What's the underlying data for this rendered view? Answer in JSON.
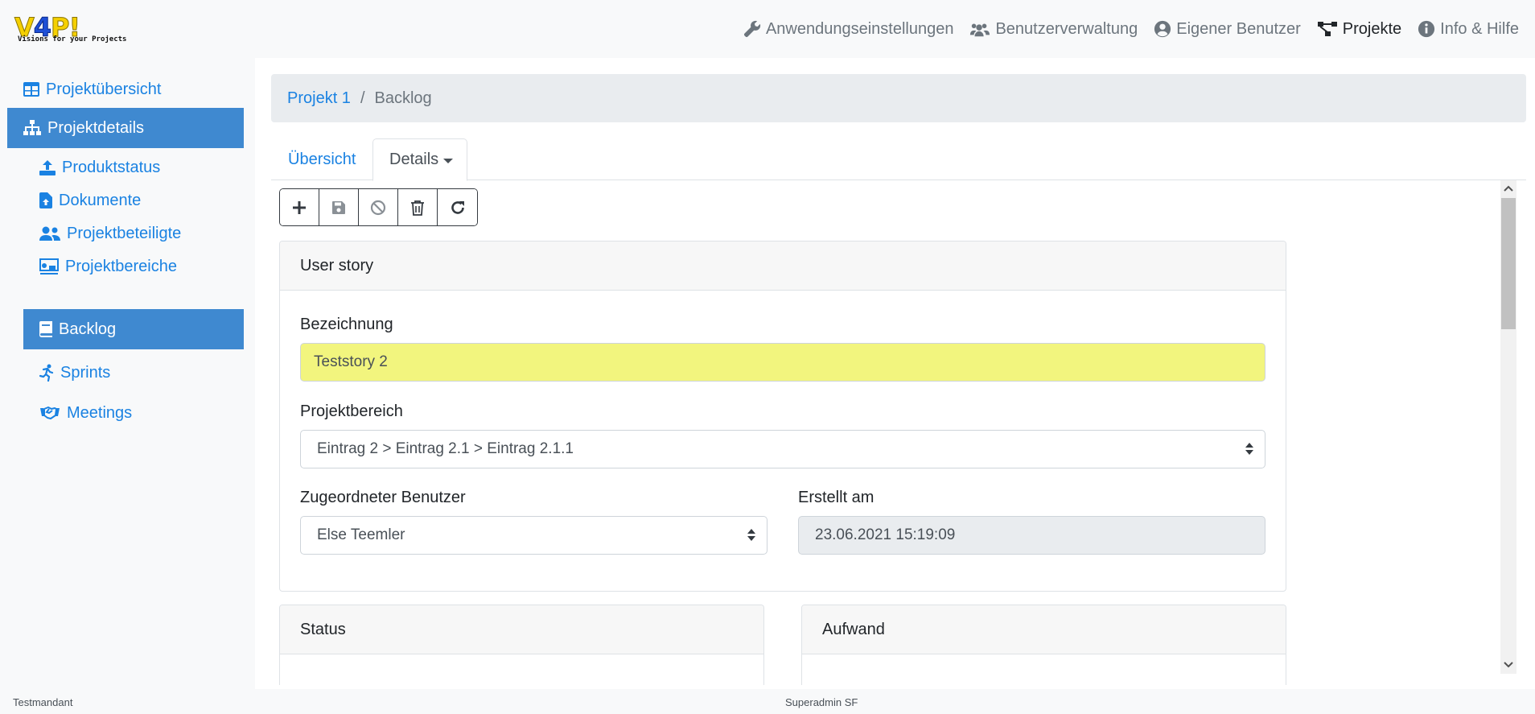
{
  "brand": {
    "logo_text": "V4P!",
    "tagline": "Visions for your Projects"
  },
  "topnav": {
    "items": [
      {
        "label": "Anwendungseinstellungen",
        "icon": "wrench-icon"
      },
      {
        "label": "Benutzerverwaltung",
        "icon": "users-gear-icon"
      },
      {
        "label": "Eigener Benutzer",
        "icon": "user-circle-icon"
      },
      {
        "label": "Projekte",
        "icon": "project-diagram-icon",
        "active": true
      },
      {
        "label": "Info & Hilfe",
        "icon": "info-circle-icon"
      }
    ]
  },
  "sidebar": {
    "items": [
      {
        "label": "Projektübersicht",
        "icon": "table-icon"
      },
      {
        "label": "Projektdetails",
        "icon": "sitemap-icon",
        "active": true
      },
      {
        "label": "Produktstatus",
        "icon": "upload-icon"
      },
      {
        "label": "Dokumente",
        "icon": "file-upload-icon"
      },
      {
        "label": "Projektbeteiligte",
        "icon": "user-group-icon"
      },
      {
        "label": "Projektbereiche",
        "icon": "chalkboard-icon"
      },
      {
        "label": "Backlog",
        "icon": "book-icon",
        "active": true
      },
      {
        "label": "Sprints",
        "icon": "running-icon"
      },
      {
        "label": "Meetings",
        "icon": "handshake-icon"
      }
    ]
  },
  "breadcrumb": {
    "project": "Projekt 1",
    "separator": "/",
    "current": "Backlog"
  },
  "tabs": {
    "overview": "Übersicht",
    "details": "Details"
  },
  "toolbar": {
    "buttons": [
      "plus-icon",
      "save-icon",
      "ban-icon",
      "trash-icon",
      "redo-icon"
    ]
  },
  "user_story": {
    "header": "User story",
    "bezeichnung_label": "Bezeichnung",
    "bezeichnung_value": "Teststory 2",
    "projektbereich_label": "Projektbereich",
    "projektbereich_value": "Eintrag 2 > Eintrag 2.1 > Eintrag 2.1.1",
    "benutzer_label": "Zugeordneter Benutzer",
    "benutzer_value": "Else Teemler",
    "erstellt_label": "Erstellt am",
    "erstellt_value": "23.06.2021 15:19:09"
  },
  "status_card": {
    "header": "Status"
  },
  "aufwand_card": {
    "header": "Aufwand"
  },
  "footer": {
    "tenant": "Testmandant",
    "user": "Superadmin SF"
  },
  "colors": {
    "link": "#1a82e2",
    "sidebar_active": "#3f89d0",
    "highlight_field": "#f2f57e"
  }
}
